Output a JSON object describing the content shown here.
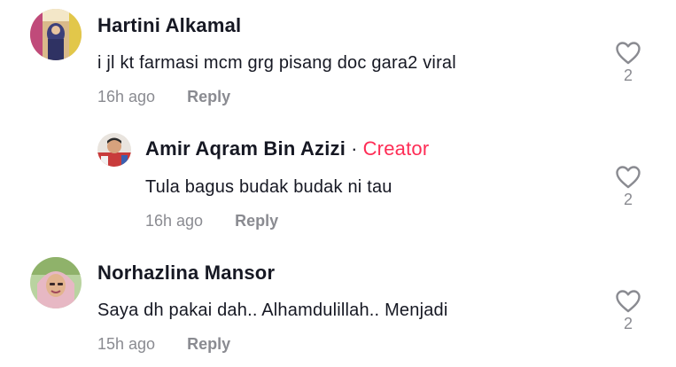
{
  "comments": [
    {
      "author": "Hartini Alkamal",
      "text": "i jl kt farmasi mcm grg pisang doc gara2 viral",
      "time": "16h ago",
      "reply_label": "Reply",
      "likes": "2",
      "icon": "heart-outline-icon"
    },
    {
      "author": "Amir Aqram Bin Azizi",
      "separator": "·",
      "badge": "Creator",
      "text": "Tula bagus budak budak ni tau",
      "time": "16h ago",
      "reply_label": "Reply",
      "likes": "2",
      "icon": "heart-outline-icon"
    },
    {
      "author": "Norhazlina Mansor",
      "text": "Saya dh pakai dah.. Alhamdulillah.. Menjadi",
      "time": "15h ago",
      "reply_label": "Reply",
      "likes": "2",
      "icon": "heart-outline-icon"
    }
  ],
  "colors": {
    "text": "#161823",
    "muted": "#8a8b91",
    "creator_badge": "#fe2c55"
  }
}
